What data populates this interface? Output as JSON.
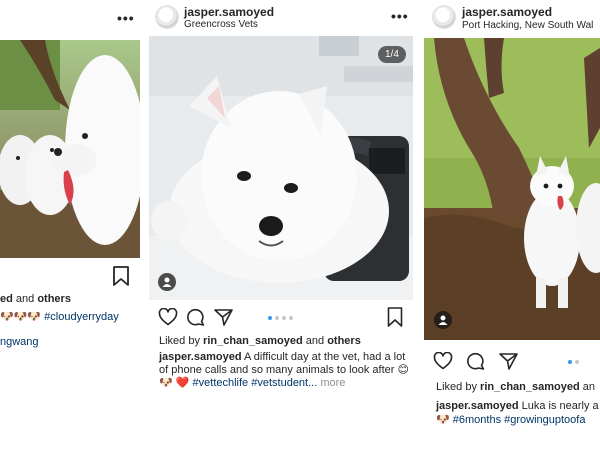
{
  "feed": {
    "left": {
      "liked_suffix": "ed",
      "liked_and": "and",
      "liked_others": "others",
      "caption_emojis": "🐶🐶🐶",
      "caption_hashtag": "#cloudyerryday",
      "caption_line2": "ngwang"
    },
    "center": {
      "username": "jasper.samoyed",
      "location": "Greencross Vets",
      "more": "•••",
      "counter": "1/4",
      "liked_prefix": "Liked by",
      "liked_user": "rin_chan_samoyed",
      "liked_and": "and",
      "liked_others": "others",
      "caption_user": "jasper.samoyed",
      "caption_text": "A difficult day at the vet, had a lot of phone calls and so many animals to look after 😊🐶",
      "caption_heart": "❤️",
      "caption_hashtags": "#vettechlife #vetstudent...",
      "caption_more": "more"
    },
    "right": {
      "username": "jasper.samoyed",
      "location": "Port Hacking, New South Wal",
      "liked_prefix": "Liked by",
      "liked_user": "rin_chan_samoyed",
      "liked_and": "an",
      "caption_user": "jasper.samoyed",
      "caption_text": "Luka is nearly a",
      "caption_emoji": "🐶",
      "caption_hashtags": "#6months #growinguptoofa"
    }
  },
  "colors": {
    "hashtag": "#003569",
    "carousel_active": "#3897f0",
    "carousel_inactive": "#c7c7c7",
    "text": "#262626",
    "muted": "#8e8e8e"
  },
  "icons": [
    "more-icon",
    "heart-icon",
    "comment-icon",
    "share-icon",
    "bookmark-icon",
    "user-tag-icon"
  ]
}
